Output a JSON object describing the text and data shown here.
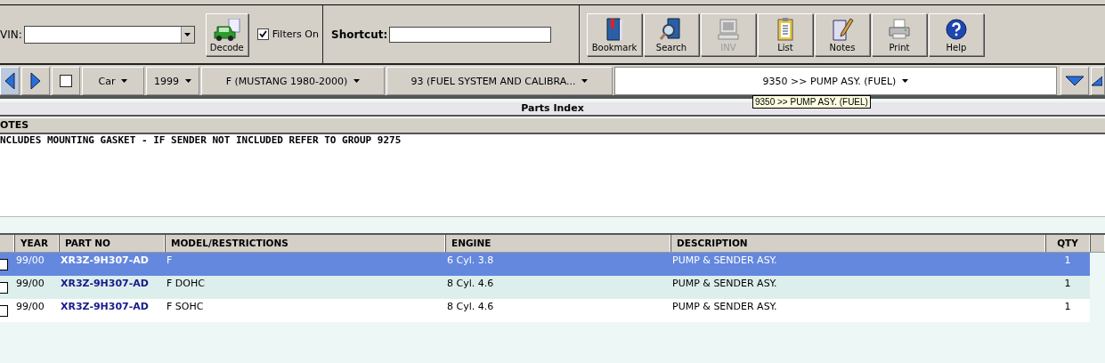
{
  "vin": {
    "label": "VIN:"
  },
  "decode_button": "Decode",
  "filters": {
    "label": "Filters On",
    "checked": true
  },
  "shortcut": {
    "label": "Shortcut:"
  },
  "tools": [
    {
      "kind": "bookmark",
      "label": "Bookmark",
      "disabled": false
    },
    {
      "kind": "search",
      "label": "Search",
      "disabled": false
    },
    {
      "kind": "inv",
      "label": "INV",
      "disabled": true
    },
    {
      "kind": "list",
      "label": "List",
      "disabled": false
    },
    {
      "kind": "notes",
      "label": "Notes",
      "disabled": false
    },
    {
      "kind": "print",
      "label": "Print",
      "disabled": false
    },
    {
      "kind": "help",
      "label": "Help",
      "disabled": false
    }
  ],
  "nav": {
    "checked": false,
    "dropdowns": [
      "Car",
      "1999",
      "F (MUSTANG 1980-2000)",
      "93 (FUEL SYSTEM AND CALIBRA..."
    ],
    "group": "9350  >> PUMP ASY. (FUEL)",
    "tooltip": "9350  >> PUMP ASY. (FUEL)"
  },
  "section_title": "Parts Index",
  "notes": {
    "heading": "OTES",
    "text": "NCLUDES MOUNTING GASKET - IF SENDER NOT INCLUDED REFER TO GROUP 9275"
  },
  "table": {
    "columns": [
      "YEAR",
      "PART NO",
      "MODEL/RESTRICTIONS",
      "ENGINE",
      "DESCRIPTION",
      "QTY"
    ],
    "rows": [
      {
        "selected": true,
        "checked": false,
        "cells": [
          "99/00",
          "XR3Z-9H307-AD",
          "F",
          "6 Cyl. 3.8",
          "PUMP & SENDER ASY.",
          "1"
        ]
      },
      {
        "selected": false,
        "checked": false,
        "cells": [
          "99/00",
          "XR3Z-9H307-AD",
          "F DOHC",
          "8 Cyl. 4.6",
          "PUMP & SENDER ASY.",
          "1"
        ]
      },
      {
        "selected": false,
        "checked": false,
        "cells": [
          "99/00",
          "XR3Z-9H307-AD",
          "F SOHC",
          "8 Cyl. 4.6",
          "PUMP & SENDER ASY.",
          "1"
        ]
      }
    ]
  }
}
